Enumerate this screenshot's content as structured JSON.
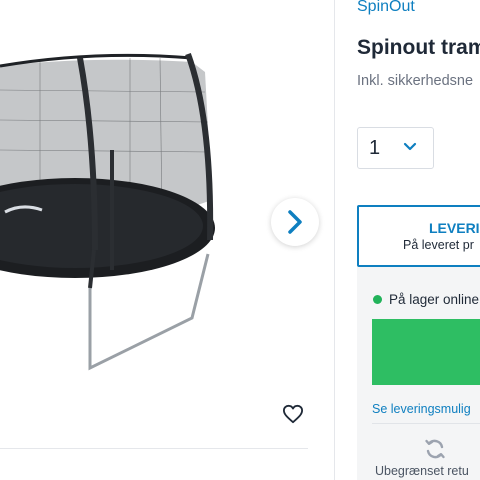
{
  "product": {
    "brand": "SpinOut",
    "title": "Spinout tram",
    "subtitle": "Inkl. sikkerhedsne",
    "image_alt": "Spinout trampolin med sikkerhedsnet"
  },
  "gallery": {
    "next_icon": "chevron-right-icon",
    "favorite_icon": "heart-icon"
  },
  "quantity": {
    "value": "1",
    "icon": "chevron-down-icon"
  },
  "delivery": {
    "title": "LEVERI",
    "subtitle": "På leveret pr"
  },
  "stock": {
    "status": "På lager online",
    "status_color": "#22b35a",
    "delivery_link": "Se leveringsmulig",
    "returns_label": "Ubegrænset retu",
    "returns_icon": "refresh-icon"
  },
  "colors": {
    "accent": "#0e7fc0",
    "cta": "#2ebe63",
    "panel_bg": "#f4f5f6"
  }
}
